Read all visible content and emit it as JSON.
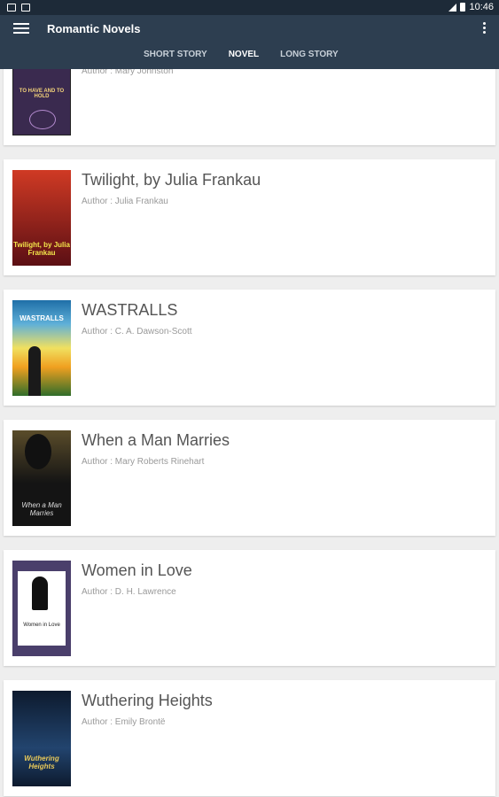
{
  "status_bar": {
    "time": "10:46"
  },
  "app_bar": {
    "title": "Romantic Novels",
    "tabs": [
      {
        "label": "SHORT STORY",
        "active": false
      },
      {
        "label": "NOVEL",
        "active": true
      },
      {
        "label": "LONG STORY",
        "active": false
      }
    ]
  },
  "books": [
    {
      "title": "",
      "author": "Author : Mary Johnston",
      "cover_text": "TO HAVE AND TO HOLD",
      "cover_colors": [
        "#3a2a4f",
        "#5a3d6e"
      ]
    },
    {
      "title": "Twilight, by Julia Frankau",
      "author": "Author : Julia Frankau",
      "cover_text": "Twilight, by Julia Frankau",
      "cover_colors": [
        "#5b0f14",
        "#b8231b"
      ]
    },
    {
      "title": "WASTRALLS",
      "author": "Author : C. A. Dawson-Scott",
      "cover_text": "WASTRALLS",
      "cover_colors": [
        "#1f6fa8",
        "#f0a020"
      ]
    },
    {
      "title": "When a Man Marries",
      "author": "Author : Mary Roberts Rinehart",
      "cover_text": "When a Man Marries",
      "cover_colors": [
        "#3a3020",
        "#141414"
      ]
    },
    {
      "title": "Women in Love",
      "author": "Author : D. H. Lawrence",
      "cover_text": "Women in Love",
      "cover_colors": [
        "#4a3f6b",
        "#ffffff"
      ]
    },
    {
      "title": "Wuthering Heights",
      "author": "Author : Emily Brontë",
      "cover_text": "Wuthering Heights",
      "cover_colors": [
        "#0d1a2e",
        "#22446e"
      ]
    }
  ]
}
